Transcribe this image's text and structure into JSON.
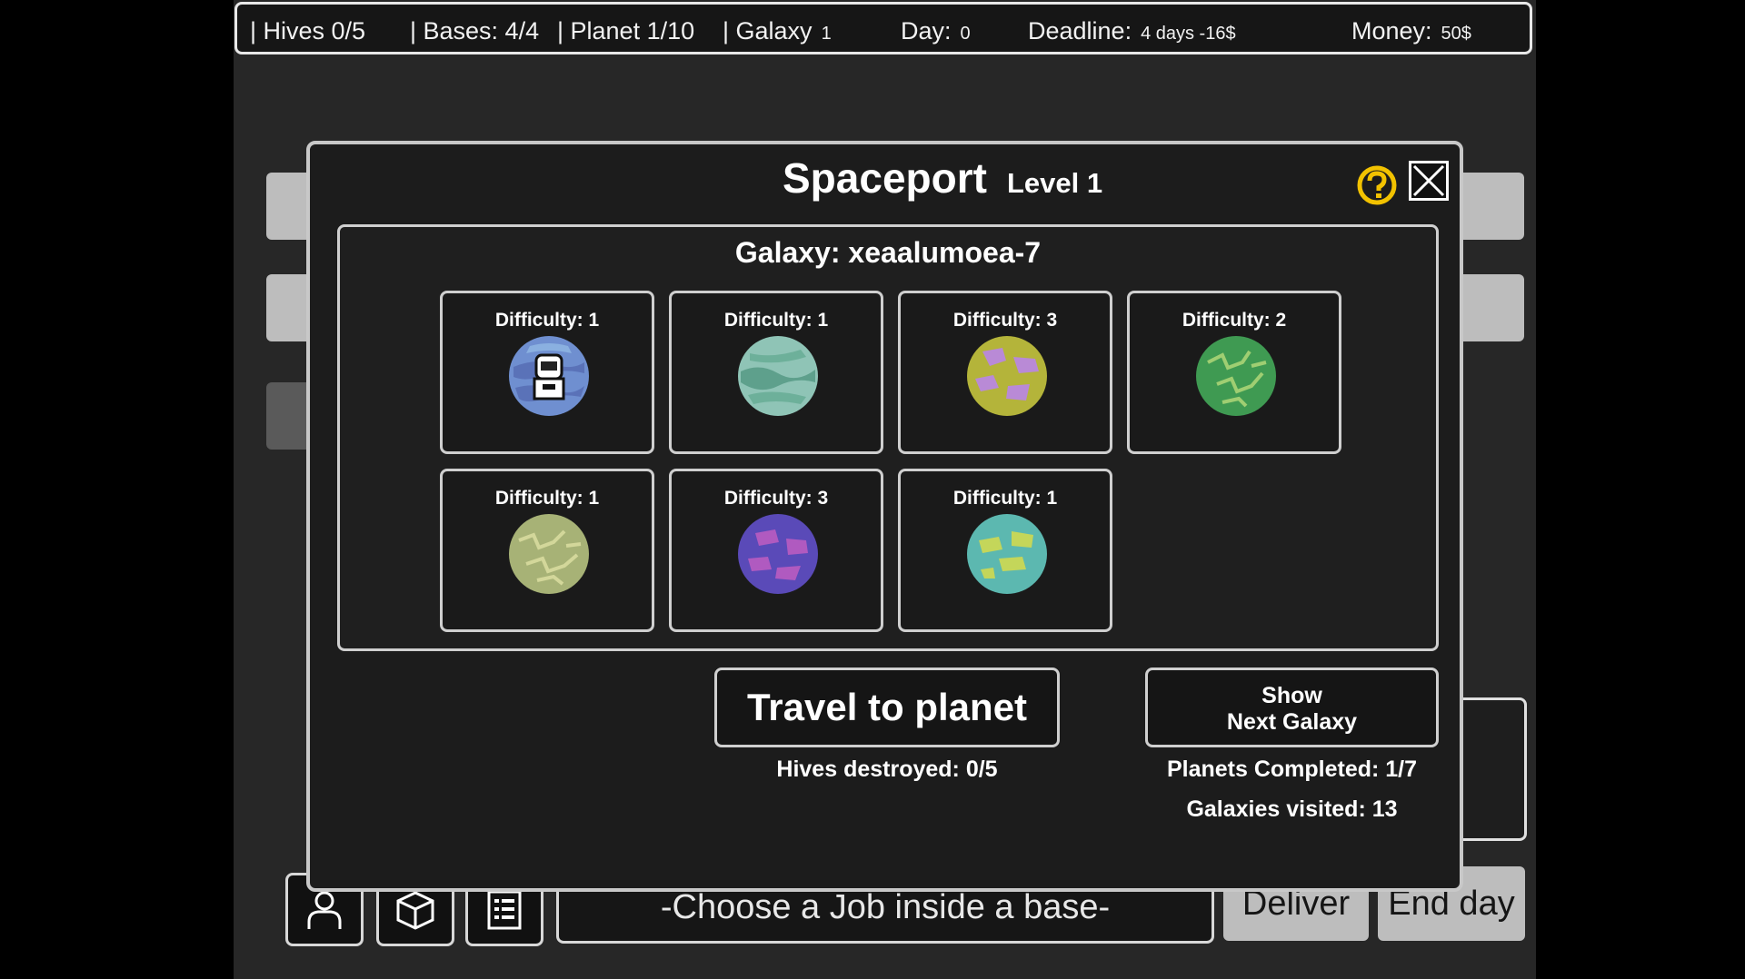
{
  "topbar": {
    "hives": "| Hives 0/5",
    "bases": "| Bases: 4/4",
    "planet": "| Planet 1/10",
    "galaxy_label": "| Galaxy",
    "galaxy_value": "1",
    "day_label": "Day:",
    "day_value": "0",
    "deadline_label": "Deadline:",
    "deadline_value": "4 days -16$",
    "money_label": "Money:",
    "money_value": "50$"
  },
  "modal": {
    "title": "Spaceport",
    "level": "Level 1",
    "help_icon": "question-circle-icon",
    "close_icon": "close-x-icon",
    "galaxy": "Galaxy: xeaalumoea-7",
    "planets": [
      {
        "difficulty": "Difficulty: 1",
        "colors": [
          "#6f8fd0",
          "#5a72b8"
        ],
        "player_here": true
      },
      {
        "difficulty": "Difficulty: 1",
        "colors": [
          "#8fc4b6",
          "#5ea08c"
        ],
        "player_here": false
      },
      {
        "difficulty": "Difficulty: 3",
        "colors": [
          "#b4b43a",
          "#b98ad6"
        ],
        "player_here": false
      },
      {
        "difficulty": "Difficulty: 2",
        "colors": [
          "#3f9a52",
          "#9fce72"
        ],
        "player_here": false
      },
      {
        "difficulty": "Difficulty: 1",
        "colors": [
          "#a7b276",
          "#d3d79a"
        ],
        "player_here": false
      },
      {
        "difficulty": "Difficulty: 3",
        "colors": [
          "#5a4ab8",
          "#b05ac0"
        ],
        "player_here": false
      },
      {
        "difficulty": "Difficulty: 1",
        "colors": [
          "#5cb8b0",
          "#c4d65a"
        ],
        "player_here": false
      }
    ],
    "travel_button": "Travel to planet",
    "next_galaxy_line1": "Show",
    "next_galaxy_line2": "Next Galaxy",
    "hives_destroyed": "Hives destroyed: 0/5",
    "planets_completed": "Planets Completed: 1/7",
    "galaxies_visited": "Galaxies visited: 13"
  },
  "bottombar": {
    "icons": [
      "character-icon",
      "cube-icon",
      "list-icon"
    ],
    "job_text": "-Choose a Job inside a base-",
    "deliver": "Deliver",
    "end_day": "End day"
  }
}
